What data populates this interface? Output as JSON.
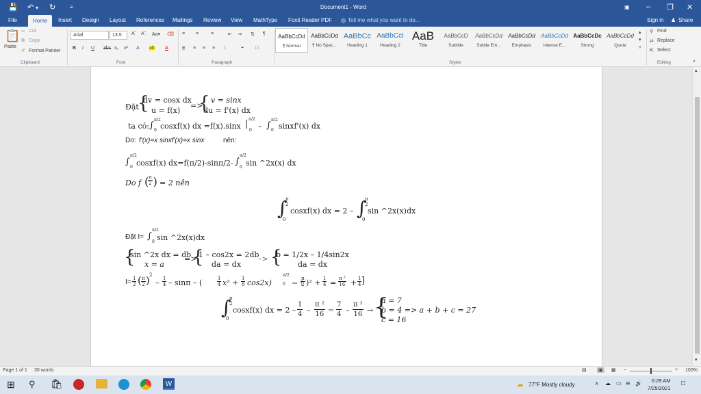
{
  "window": {
    "title": "Document1 - Word",
    "signin": "Sign in",
    "share": "Share"
  },
  "tabs": [
    "File",
    "Home",
    "Insert",
    "Design",
    "Layout",
    "References",
    "Mailings",
    "Review",
    "View",
    "MathType",
    "Foxit Reader PDF"
  ],
  "tellme": "Tell me what you want to do...",
  "clipboard": {
    "paste": "Paste",
    "cut": "Cut",
    "copy": "Copy",
    "format_painter": "Format Painter",
    "group": "Clipboard"
  },
  "font": {
    "name": "Arial",
    "size": "13.5",
    "group": "Font"
  },
  "paragraph": {
    "group": "Paragraph"
  },
  "styles": {
    "group": "Styles",
    "items": [
      {
        "sample": "AaBbCcDd",
        "name": "¶ Normal"
      },
      {
        "sample": "AaBbCcDd",
        "name": "¶ No Spac..."
      },
      {
        "sample": "AaBbCc",
        "name": "Heading 1"
      },
      {
        "sample": "AaBbCcI",
        "name": "Heading 2"
      },
      {
        "sample": "AaB",
        "name": "Title"
      },
      {
        "sample": "AaBbCcD",
        "name": "Subtitle"
      },
      {
        "sample": "AaBbCcDd",
        "name": "Subtle Em..."
      },
      {
        "sample": "AaBbCcDd",
        "name": "Emphasis"
      },
      {
        "sample": "AaBbCcDd",
        "name": "Intense E..."
      },
      {
        "sample": "AaBbCcDc",
        "name": "Strong"
      },
      {
        "sample": "AaBbCcDd",
        "name": "Quote"
      }
    ]
  },
  "editing": {
    "find": "Find",
    "replace": "Replace",
    "select": "Select",
    "group": "Editing"
  },
  "doc": {
    "l1_dat": "Đặt",
    "l1_r1": "dv = cosx dx",
    "l1_r2": "u = f(x)",
    "l1_arrow": "=>",
    "l1_r3": "v = sinx",
    "l1_r4": "du = f'(x) dx",
    "l2_taco": "ta có:",
    "l2_a": "cosxf(x) dx =f(x).sinx",
    "l2_b": "–",
    "l2_c": "sinxf'(x) dx",
    "l3_do": "Do:",
    "l3_a": "f'(x)=x  sinxf'(x)=x sinx",
    "l3_b": "nên:",
    "l4_a": "cosxf(x) dx=f(π/2)-sinπ/2-",
    "l4_b": "sin  ^2x(x) dx",
    "l5_a": "Do f",
    "l5_b": "= 2 nên",
    "l6_a": "cosxf(x) dx = 2 –",
    "l6_b": "sin  ^2x(x)dx",
    "l7_a": "Đặt I=",
    "l7_b": "sin  ^2x(x)dx",
    "l8_r1": "sin ^2x dx = db",
    "l8_r2": "x = a",
    "l8_arrow": "=>",
    "l8_r3": "1 – cos2x = 2db",
    "l8_r4": "da = dx",
    "l8_arrow2": "–>",
    "l8_r5": "b = 1/2x – 1/4sin2x",
    "l8_r6": "da = dx",
    "l9_a": "I=",
    "l9_b": "– sinπ – (",
    "l9_c": "x² +",
    "l9_d": "cos2x)",
    "l9_e": "= (",
    "l9_f": ")² +",
    "l9_g": "=",
    "l9_h": "+",
    "l10_a": "cosxf(x) dx = 2 –",
    "l10_b": "–",
    "l10_c": "=",
    "l10_d": "–",
    "l10_e": "→",
    "l10_s1": "a = 7",
    "l10_s2": "b = 4  => a + b + c = 27",
    "l10_s3": "c = 16",
    "pi": "π",
    "pi2": "π ²",
    "zero": "0",
    "two": "2",
    "one": "1",
    "four": "4",
    "seven": "7",
    "sixteen": "16",
    "eight": "8",
    "sq": "2"
  },
  "status": {
    "page": "Page 1 of 1",
    "words": "30 words",
    "zoom": "100%"
  },
  "taskbar": {
    "weather": "77°F  Mostly cloudy",
    "time": "6:29 AM",
    "date": "7/25/2021"
  }
}
